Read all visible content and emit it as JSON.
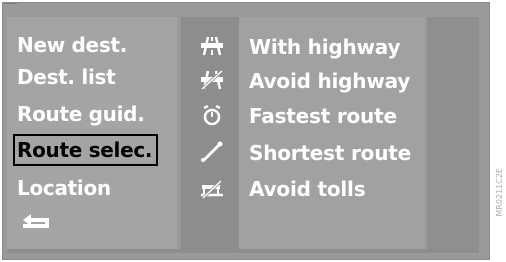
{
  "menu": {
    "items": [
      {
        "label": "New dest.",
        "selected": false
      },
      {
        "label": "Dest. list",
        "selected": false
      },
      {
        "label": "Route guid.",
        "selected": false
      },
      {
        "label": "Route selec.",
        "selected": true
      },
      {
        "label": "Location",
        "selected": false
      }
    ],
    "back_icon": "back-arrow-icon"
  },
  "options": [
    {
      "icon": "highway-icon",
      "label": "With highway"
    },
    {
      "icon": "avoid-highway-icon",
      "label": "Avoid highway"
    },
    {
      "icon": "stopwatch-icon",
      "label": "Fastest route"
    },
    {
      "icon": "shortest-route-icon",
      "label": "Shortest route"
    },
    {
      "icon": "avoid-tolls-icon",
      "label": "Avoid tolls"
    }
  ],
  "watermark": "MR0211C2E",
  "colors": {
    "text": "#ffffff",
    "selected_text": "#000000",
    "background": "#9a9a9a"
  }
}
